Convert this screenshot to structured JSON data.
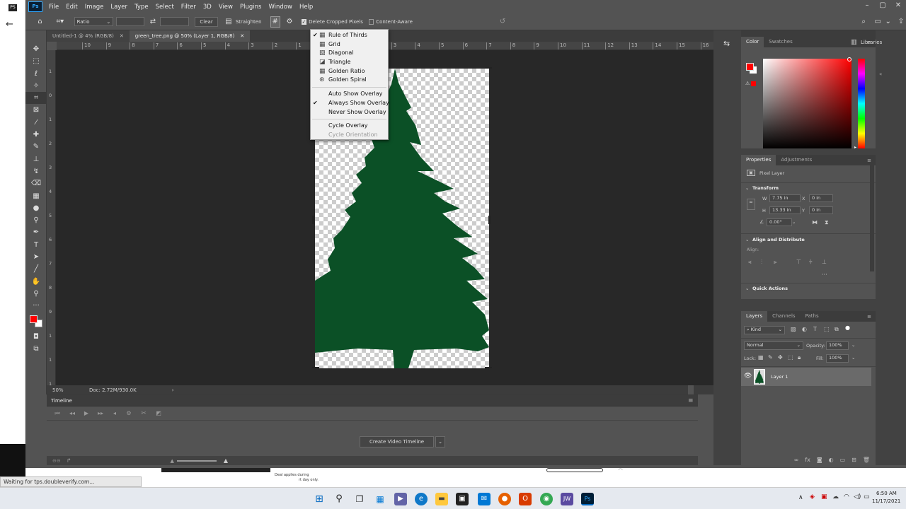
{
  "browser": {
    "status": "Waiting for tps.doubleverify.com..."
  },
  "ad": {
    "line1": "Deal applies during",
    "line2": "rt day only."
  },
  "menubar": {
    "items": [
      "File",
      "Edit",
      "Image",
      "Layer",
      "Type",
      "Select",
      "Filter",
      "3D",
      "View",
      "Plugins",
      "Window",
      "Help"
    ]
  },
  "options": {
    "ratio_value": "Ratio",
    "clear_label": "Clear",
    "straighten_label": "Straighten",
    "delete_cropped_label": "Delete Cropped Pixels",
    "content_aware_label": "Content-Aware"
  },
  "tabs": [
    {
      "label": "Untitled-1 @ 4% (RGB/8)"
    },
    {
      "label": "green_tree.png @ 50% (Layer 1, RGB/8)"
    }
  ],
  "hruler": {
    "ticks": [
      "10",
      "9",
      "8",
      "7",
      "6",
      "5",
      "4",
      "3",
      "2",
      "1",
      "0",
      "1",
      "2",
      "3",
      "4",
      "5",
      "6",
      "7",
      "8",
      "9",
      "10",
      "11",
      "12",
      "13",
      "14",
      "15",
      "16",
      "17"
    ]
  },
  "vruler": {
    "ticks": [
      "1",
      "0",
      "1",
      "2",
      "3",
      "4",
      "5",
      "6",
      "7",
      "8",
      "9",
      "1",
      "1",
      "1",
      "1"
    ]
  },
  "overlay_menu": {
    "items": [
      {
        "label": "Rule of Thirds",
        "checked": true,
        "glyph": "▦"
      },
      {
        "label": "Grid",
        "checked": false,
        "glyph": "▦"
      },
      {
        "label": "Diagonal",
        "checked": false,
        "glyph": "▨"
      },
      {
        "label": "Triangle",
        "checked": false,
        "glyph": "◪"
      },
      {
        "label": "Golden Ratio",
        "checked": false,
        "glyph": "▦"
      },
      {
        "label": "Golden Spiral",
        "checked": false,
        "glyph": "⊛"
      }
    ],
    "show_items": [
      {
        "label": "Auto Show Overlay",
        "checked": false
      },
      {
        "label": "Always Show Overlay",
        "checked": true
      },
      {
        "label": "Never Show Overlay",
        "checked": false
      }
    ],
    "cycle_overlay": "Cycle Overlay",
    "cycle_orientation": "Cycle Orientation"
  },
  "status": {
    "zoom": "50%",
    "doc": "Doc: 2.72M/930.0K"
  },
  "timeline": {
    "title": "Timeline",
    "create_button": "Create Video Timeline"
  },
  "color_panel": {
    "tabs": [
      "Color",
      "Swatches"
    ],
    "foreground": "#ff0000",
    "background": "#ffffff"
  },
  "libraries": {
    "label": "Libraries"
  },
  "properties": {
    "tabs": [
      "Properties",
      "Adjustments"
    ],
    "pixel_layer": "Pixel Layer",
    "transform_title": "Transform",
    "w_label": "W",
    "w_value": "7.75 in",
    "h_label": "H",
    "h_value": "13.33 in",
    "x_label": "X",
    "x_value": "0 in",
    "y_label": "Y",
    "y_value": "0 in",
    "angle_value": "0.00°",
    "align_title": "Align and Distribute",
    "align_label": "Align:",
    "quick_actions": "Quick Actions"
  },
  "layers": {
    "tabs": [
      "Layers",
      "Channels",
      "Paths"
    ],
    "kind": "Kind",
    "blend_mode": "Normal",
    "opacity_label": "Opacity:",
    "opacity_value": "100%",
    "lock_label": "Lock:",
    "fill_label": "Fill:",
    "fill_value": "100%",
    "layer_name": "Layer 1"
  },
  "tray": {
    "time": "6:50 AM",
    "date": "11/17/2021"
  },
  "colors": {
    "tree": "#0b5026",
    "accent": "#1473e6"
  }
}
